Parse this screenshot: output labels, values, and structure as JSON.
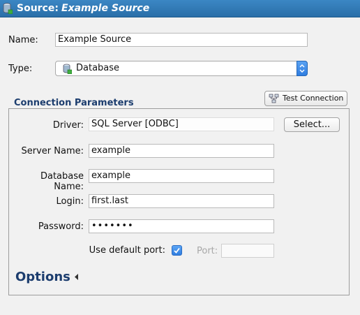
{
  "window": {
    "title_prefix": "Source:",
    "title_name": "Example Source",
    "icon": "database-icon"
  },
  "form": {
    "name_label": "Name:",
    "name_value": "Example Source",
    "type_label": "Type:",
    "type_value": "Database",
    "type_icon": "database-icon"
  },
  "connection": {
    "title": "Connection Parameters",
    "test_button": "Test Connection",
    "test_icon": "network-icon",
    "driver_label": "Driver:",
    "driver_value": "SQL Server [ODBC]",
    "select_button": "Select...",
    "server_label": "Server Name:",
    "server_value": "example",
    "database_label": "Database Name:",
    "database_value": "example",
    "login_label": "Login:",
    "login_value": "first.last",
    "password_label": "Password:",
    "password_masked": "•••••••",
    "default_port_label": "Use default port:",
    "default_port_checked": true,
    "port_label": "Port:",
    "port_value": "",
    "accent_color": "#2f7de0"
  },
  "options": {
    "label": "Options",
    "icon": "disclosure-triangle-icon",
    "expanded": false
  }
}
